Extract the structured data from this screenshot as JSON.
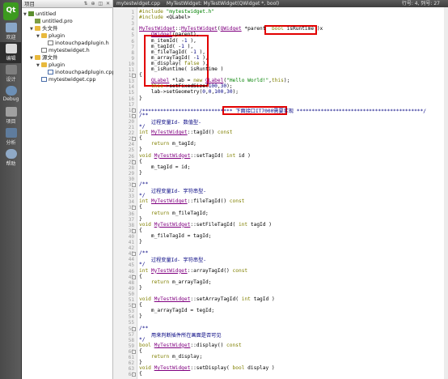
{
  "modebar": {
    "items": [
      {
        "name": "welcome",
        "label": "欢迎"
      },
      {
        "name": "edit",
        "label": "编辑"
      },
      {
        "name": "design",
        "label": "设计"
      },
      {
        "name": "debug",
        "label": "Debug"
      },
      {
        "name": "projects",
        "label": "项目"
      },
      {
        "name": "analyze",
        "label": "分析"
      },
      {
        "name": "help",
        "label": "帮助"
      }
    ]
  },
  "project": {
    "header_label": "项目",
    "header_controls": "⇅ ⊕ ◫ ✕",
    "tree": [
      {
        "label": "untitled",
        "type": "proj"
      },
      {
        "label": "untitled.pro",
        "type": "pro"
      },
      {
        "label": "头文件",
        "type": "folder"
      },
      {
        "label": "plugin",
        "type": "folder"
      },
      {
        "label": "inotouchpadplugin.h",
        "type": "h"
      },
      {
        "label": "mytestwidget.h",
        "type": "h"
      },
      {
        "label": "源文件",
        "type": "folder"
      },
      {
        "label": "plugin",
        "type": "folder"
      },
      {
        "label": "inotouchpadplugin.cpp",
        "type": "cpp"
      },
      {
        "label": "mytestwidget.cpp",
        "type": "cpp"
      }
    ]
  },
  "editor": {
    "toolbar": {
      "file": "mytestwidget.cpp",
      "symbol": "MyTestWidget: MyTestWidget(QWidget *, bool)",
      "position": "行号: 4, 列号: 27"
    },
    "lines": [
      {
        "n": "1",
        "t": "#include \"mytestwidget.h\""
      },
      {
        "n": "2",
        "t": "#include <QLabel>"
      },
      {
        "n": "3",
        "t": ""
      },
      {
        "n": "4",
        "t": "MyTestWidget::MyTestWidget(QWidget *parent  bool isRuntime )x"
      },
      {
        "n": "5",
        "t": "    QWidget(parent),"
      },
      {
        "n": "6",
        "t": "    m_itemId( -1 ),"
      },
      {
        "n": "7",
        "t": "    m_tagId( -1 ),"
      },
      {
        "n": "8",
        "t": "    m_fileTagId( -1 ),"
      },
      {
        "n": "9",
        "t": "    m_arrayTagId( -1 ),"
      },
      {
        "n": "10",
        "t": "    m_display( false ),"
      },
      {
        "n": "11",
        "t": "    m_isRuntime( isRuntime )"
      },
      {
        "n": "12",
        "t": "{"
      },
      {
        "n": "13",
        "t": "    QLabel *lab = new QLabel(\"Hello World!\",this);"
      },
      {
        "n": "14",
        "t": "    this->setFixedSize(100,30);"
      },
      {
        "n": "15",
        "t": "    lab->setGeometry(0,0,100,30);"
      },
      {
        "n": "16",
        "t": "}"
      },
      {
        "n": "17",
        "t": ""
      },
      {
        "n": "18",
        "t": "/****************************** 下面接口IT7000需要实现 ******************************************/"
      },
      {
        "n": "19",
        "t": "/**"
      },
      {
        "n": "20",
        "t": "    过程变量Id- 数值型-"
      },
      {
        "n": "21",
        "t": "*/"
      },
      {
        "n": "22",
        "t": "int MyTestWidget::tagId() const"
      },
      {
        "n": "23",
        "t": "{"
      },
      {
        "n": "24",
        "t": "    return m_tagId;"
      },
      {
        "n": "25",
        "t": "}"
      },
      {
        "n": "26",
        "t": "void MyTestWidget::setTagId( int id )"
      },
      {
        "n": "27",
        "t": "{"
      },
      {
        "n": "28",
        "t": "    m_tagId = id;"
      },
      {
        "n": "29",
        "t": "}"
      },
      {
        "n": "30",
        "t": ""
      },
      {
        "n": "31",
        "t": "/**"
      },
      {
        "n": "32",
        "t": "    过程变量Id- 字符串型-"
      },
      {
        "n": "33",
        "t": "*/"
      },
      {
        "n": "34",
        "t": "int MyTestWidget::fileTagId() const"
      },
      {
        "n": "35",
        "t": "{"
      },
      {
        "n": "36",
        "t": "    return m_fileTagId;"
      },
      {
        "n": "37",
        "t": "}"
      },
      {
        "n": "38",
        "t": "void MyTestWidget::setFileTagId( int tagId )"
      },
      {
        "n": "39",
        "t": "{"
      },
      {
        "n": "40",
        "t": "    m_fileTagId = tagId;"
      },
      {
        "n": "41",
        "t": "}"
      },
      {
        "n": "42",
        "t": ""
      },
      {
        "n": "43",
        "t": "/**"
      },
      {
        "n": "44",
        "t": "    过程变量Id- 字符串型-"
      },
      {
        "n": "45",
        "t": "*/"
      },
      {
        "n": "46",
        "t": "int MyTestWidget::arrayTagId() const"
      },
      {
        "n": "47",
        "t": "{"
      },
      {
        "n": "48",
        "t": "    return m_arrayTagId;"
      },
      {
        "n": "49",
        "t": "}"
      },
      {
        "n": "50",
        "t": ""
      },
      {
        "n": "51",
        "t": "void MyTestWidget::setArrayTagId( int tagId )"
      },
      {
        "n": "52",
        "t": "{"
      },
      {
        "n": "53",
        "t": "    m_arrayTagId = tegId;"
      },
      {
        "n": "54",
        "t": "}"
      },
      {
        "n": "55",
        "t": ""
      },
      {
        "n": "56",
        "t": "/**"
      },
      {
        "n": "57",
        "t": "    用来判断插件所在画面是否可见"
      },
      {
        "n": "58",
        "t": "*/"
      },
      {
        "n": "59",
        "t": "bool MyTestWidget::display() const"
      },
      {
        "n": "60",
        "t": "{"
      },
      {
        "n": "61",
        "t": "    return m_display;"
      },
      {
        "n": "62",
        "t": "}"
      },
      {
        "n": "63",
        "t": "void MyTestWidget::setDisplay( bool display )"
      },
      {
        "n": "64",
        "t": "{"
      }
    ]
  },
  "colors": {
    "annotation_red": "#e20000",
    "keyword": "#808000",
    "class": "#800080",
    "number": "#000080",
    "string": "#008000"
  }
}
